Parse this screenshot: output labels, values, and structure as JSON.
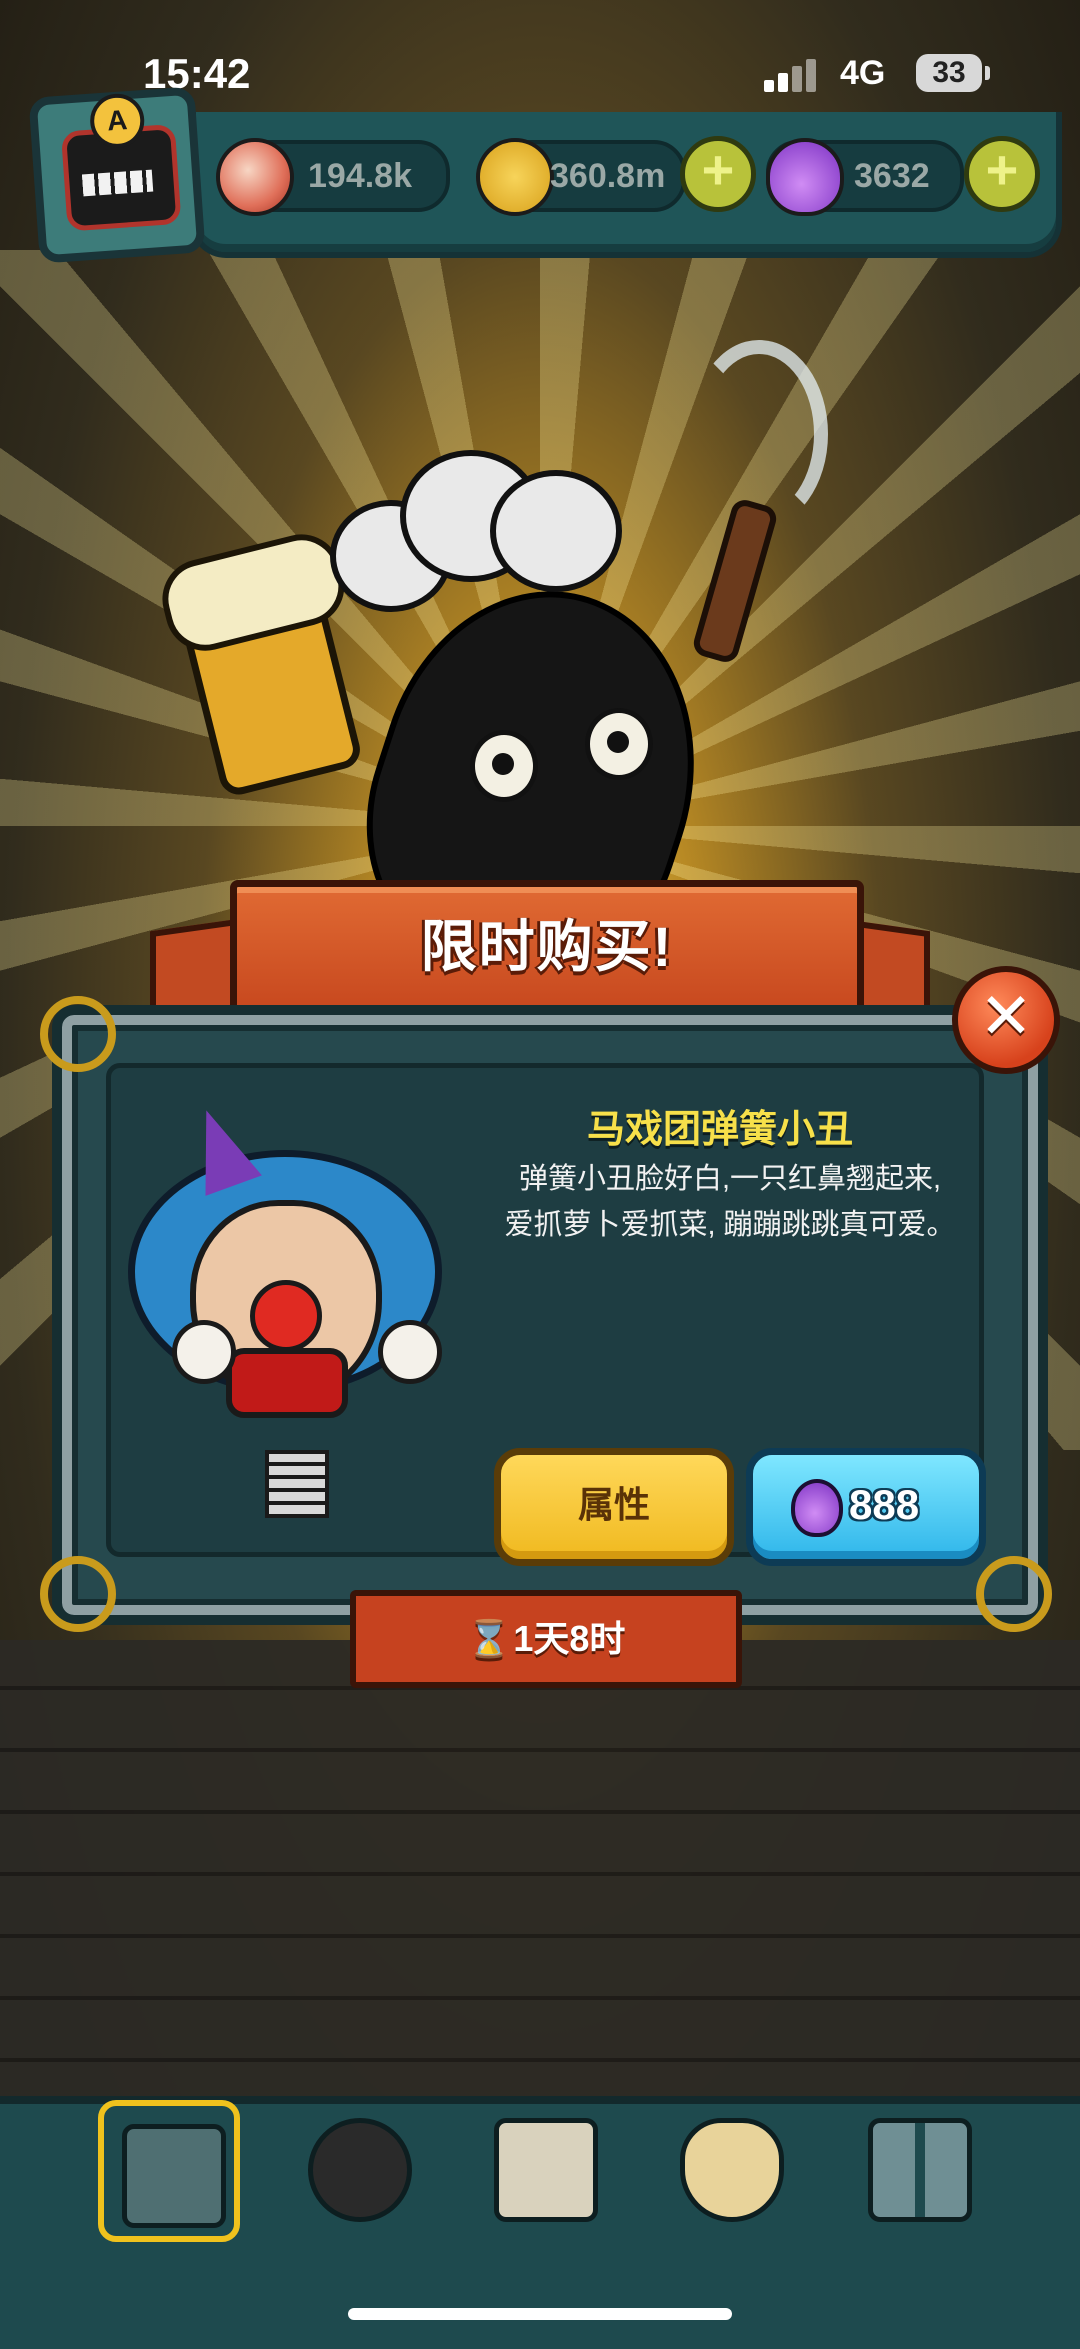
{
  "status_bar": {
    "time": "15:42",
    "network": "4G",
    "battery": "33"
  },
  "resources": {
    "eyes": {
      "icon": "eyeball-icon",
      "value": "194.8k"
    },
    "coins": {
      "icon": "coin-icon",
      "value": "360.8m"
    },
    "potions": {
      "icon": "potion-icon",
      "value": "3632"
    }
  },
  "offer": {
    "banner_title": "限时购买!",
    "item_name": "马戏团弹簧小丑",
    "description_line1": "弹簧小丑脸好白,一只红鼻翘起来,",
    "description_line2": "爱抓萝卜爱抓菜, 蹦蹦跳跳真可爱。",
    "attributes_button": "属性",
    "price": "888",
    "price_icon": "potion-icon",
    "timer_icon": "⌛",
    "timer": "1天8时"
  },
  "colors": {
    "panel": "#26494e",
    "ribbon": "#c8491f",
    "gold": "#f0b91f",
    "buy_button": "#2fb6ea",
    "item_name": "#f7e04a"
  },
  "bottom_nav": [
    "restaurant-icon",
    "monster-icon",
    "book-icon",
    "money-bag-icon",
    "grid-menu-icon"
  ]
}
